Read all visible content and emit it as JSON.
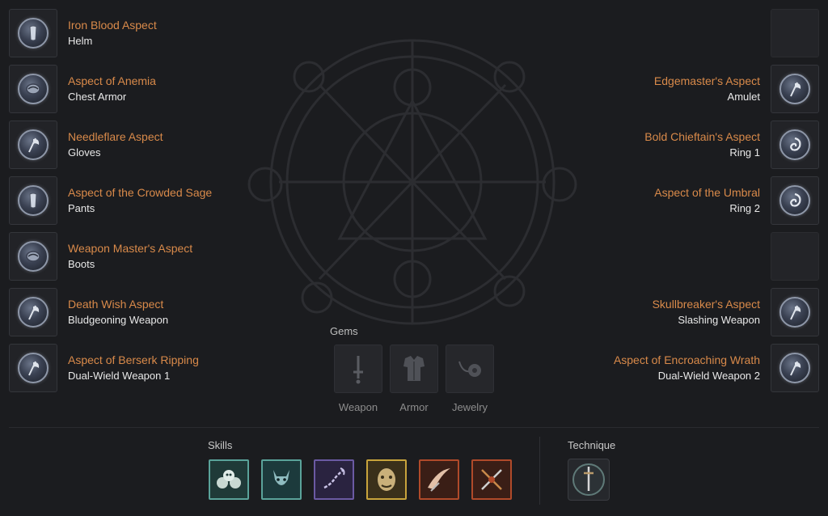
{
  "left_slots": [
    {
      "aspect": "Iron Blood Aspect",
      "slot": "Helm",
      "icon": "helm-aspect-icon"
    },
    {
      "aspect": "Aspect of Anemia",
      "slot": "Chest Armor",
      "icon": "chest-aspect-icon"
    },
    {
      "aspect": "Needleflare Aspect",
      "slot": "Gloves",
      "icon": "axe-aspect-icon"
    },
    {
      "aspect": "Aspect of the Crowded Sage",
      "slot": "Pants",
      "icon": "helm-aspect-icon"
    },
    {
      "aspect": "Weapon Master's Aspect",
      "slot": "Boots",
      "icon": "chest-aspect-icon"
    },
    {
      "aspect": "Death Wish Aspect",
      "slot": "Bludgeoning Weapon",
      "icon": "axe-aspect-icon"
    },
    {
      "aspect": "Aspect of Berserk Ripping",
      "slot": "Dual-Wield Weapon 1",
      "icon": "axe-aspect-icon"
    }
  ],
  "right_slots": [
    {
      "aspect": "",
      "slot": "",
      "empty": true
    },
    {
      "aspect": "Edgemaster's Aspect",
      "slot": "Amulet",
      "icon": "axe-aspect-icon"
    },
    {
      "aspect": "Bold Chieftain's Aspect",
      "slot": "Ring 1",
      "icon": "swirl-aspect-icon"
    },
    {
      "aspect": "Aspect of the Umbral",
      "slot": "Ring 2",
      "icon": "swirl-aspect-icon"
    },
    {
      "aspect": "",
      "slot": "",
      "empty": true
    },
    {
      "aspect": "Skullbreaker's Aspect",
      "slot": "Slashing Weapon",
      "icon": "axe-aspect-icon"
    },
    {
      "aspect": "Aspect of Encroaching Wrath",
      "slot": "Dual-Wield Weapon 2",
      "icon": "axe-aspect-icon"
    }
  ],
  "gems": {
    "title": "Gems",
    "items": [
      {
        "label": "Weapon",
        "icon": "sword-gem-icon"
      },
      {
        "label": "Armor",
        "icon": "armor-gem-icon"
      },
      {
        "label": "Jewelry",
        "icon": "amulet-gem-icon"
      }
    ]
  },
  "skills": {
    "title": "Skills",
    "items": [
      {
        "icon": "skulls-skill-icon",
        "color": "#5aa39a"
      },
      {
        "icon": "demon-skill-icon",
        "color": "#5aa39a"
      },
      {
        "icon": "chain-skill-icon",
        "color": "#6b5aa3"
      },
      {
        "icon": "mask-skill-icon",
        "color": "#c8a43c"
      },
      {
        "icon": "slash-skill-icon",
        "color": "#b04a2a"
      },
      {
        "icon": "weapons-skill-icon",
        "color": "#b04a2a"
      }
    ]
  },
  "technique": {
    "title": "Technique",
    "icon": "sword-technique-icon"
  },
  "colors": {
    "aspect_name": "#d98a4a",
    "background": "#1b1c1f"
  }
}
